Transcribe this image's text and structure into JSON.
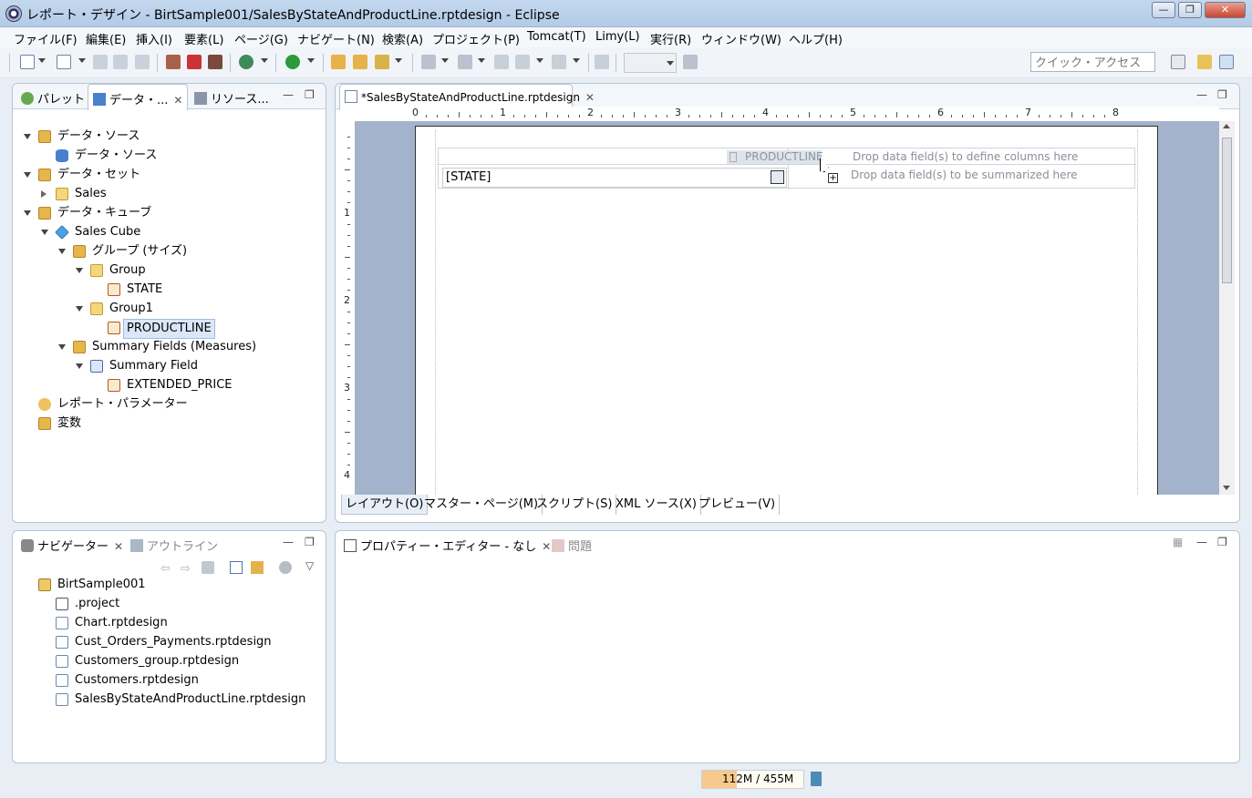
{
  "window": {
    "title": "レポート・デザイン - BirtSample001/SalesByStateAndProductLine.rptdesign - Eclipse",
    "min": "—",
    "max": "❐",
    "close": "✕"
  },
  "menu": [
    "ファイル(F)",
    "編集(E)",
    "挿入(I)",
    "要素(L)",
    "ページ(G)",
    "ナビゲート(N)",
    "検索(A)",
    "プロジェクト(P)",
    "Tomcat(T)",
    "Limy(L)",
    "実行(R)",
    "ウィンドウ(W)",
    "ヘルプ(H)"
  ],
  "quick_access": {
    "placeholder": "クイック・アクセス"
  },
  "left_top": {
    "tabs": [
      "パレット",
      "データ・...",
      "リソース..."
    ],
    "tree": [
      {
        "label": "データ・ソース",
        "level": 0,
        "icon": "folder",
        "tw": "open"
      },
      {
        "label": "データ・ソース",
        "level": 1,
        "icon": "db"
      },
      {
        "label": "データ・セット",
        "level": 0,
        "icon": "folder",
        "tw": "open"
      },
      {
        "label": "Sales",
        "level": 1,
        "icon": "group",
        "tw": "closed"
      },
      {
        "label": "データ・キューブ",
        "level": 0,
        "icon": "folder",
        "tw": "open"
      },
      {
        "label": "Sales Cube",
        "level": 1,
        "icon": "cube",
        "tw": "open"
      },
      {
        "label": "グループ (サイズ)",
        "level": 2,
        "icon": "folder",
        "tw": "open"
      },
      {
        "label": "Group",
        "level": 3,
        "icon": "group",
        "tw": "open"
      },
      {
        "label": "STATE",
        "level": 4,
        "icon": "field"
      },
      {
        "label": "Group1",
        "level": 3,
        "icon": "group",
        "tw": "open"
      },
      {
        "label": "PRODUCTLINE",
        "level": 4,
        "icon": "field",
        "selected": true
      },
      {
        "label": "Summary Fields (Measures)",
        "level": 2,
        "icon": "folder",
        "tw": "open"
      },
      {
        "label": "Summary Field",
        "level": 3,
        "icon": "sum",
        "tw": "open"
      },
      {
        "label": "EXTENDED_PRICE",
        "level": 4,
        "icon": "field"
      },
      {
        "label": "レポート・パラメーター",
        "level": 0,
        "icon": "param"
      },
      {
        "label": "変数",
        "level": 0,
        "icon": "folder"
      }
    ]
  },
  "editor": {
    "tab": "*SalesByStateAndProductLine.rptdesign",
    "ruler_numbers": [
      "0",
      "1",
      "2",
      "3",
      "4",
      "5",
      "6",
      "7",
      "8"
    ],
    "vruler_numbers": [
      "1",
      "2",
      "3",
      "4"
    ],
    "drag_label": "PRODUCTLINE",
    "drop_columns": "Drop data field(s) to define columns here",
    "drop_summary": "Drop data field(s) to be summarized here",
    "row_field": "[STATE]",
    "bottom_tabs": [
      "レイアウト(O)",
      "マスター・ページ(M)",
      "スクリプト(S)",
      "XML ソース(X)",
      "プレビュー(V)"
    ]
  },
  "navigator": {
    "tabs": [
      "ナビゲーター",
      "アウトライン"
    ],
    "items": [
      {
        "label": "BirtSample001",
        "level": 0,
        "icon": "proj"
      },
      {
        "label": ".project",
        "level": 1,
        "icon": "x"
      },
      {
        "label": "Chart.rptdesign",
        "level": 1,
        "icon": "file"
      },
      {
        "label": "Cust_Orders_Payments.rptdesign",
        "level": 1,
        "icon": "file"
      },
      {
        "label": "Customers_group.rptdesign",
        "level": 1,
        "icon": "file"
      },
      {
        "label": "Customers.rptdesign",
        "level": 1,
        "icon": "file"
      },
      {
        "label": "SalesByStateAndProductLine.rptdesign",
        "level": 1,
        "icon": "file"
      }
    ]
  },
  "properties": {
    "tabs": [
      "プロパティー・エディター - なし",
      "問題"
    ]
  },
  "status": {
    "memory_used": "112M",
    "memory_sep": " / ",
    "memory_total": "455M",
    "memory_fraction": 0.246
  }
}
